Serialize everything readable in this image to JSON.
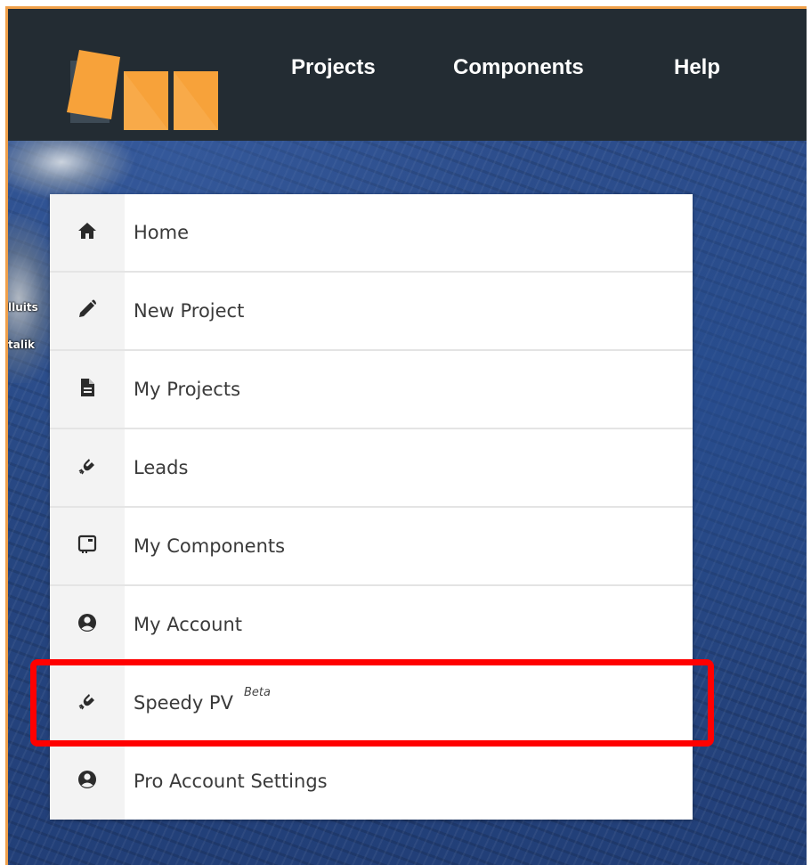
{
  "header": {
    "nav": [
      {
        "label": "Projects"
      },
      {
        "label": "Components"
      },
      {
        "label": "Help"
      }
    ],
    "colors": {
      "bar": "#232c33",
      "logo_orange": "#f7a23a",
      "logo_dark": "#3d4a55"
    }
  },
  "map": {
    "labels": [
      "lluits",
      "talik"
    ]
  },
  "menu": {
    "items": [
      {
        "label": "Home",
        "icon": "home-icon"
      },
      {
        "label": "New Project",
        "icon": "pencil-icon"
      },
      {
        "label": "My Projects",
        "icon": "file-icon"
      },
      {
        "label": "Leads",
        "icon": "magnet-icon"
      },
      {
        "label": "My Components",
        "icon": "component-icon"
      },
      {
        "label": "My Account",
        "icon": "user-circle-icon"
      },
      {
        "label": "Speedy PV",
        "badge": "Beta",
        "icon": "magnet-icon",
        "highlighted": true
      },
      {
        "label": "Pro Account Settings",
        "icon": "user-circle-icon"
      }
    ]
  },
  "annotation": {
    "color": "#ff0000"
  }
}
